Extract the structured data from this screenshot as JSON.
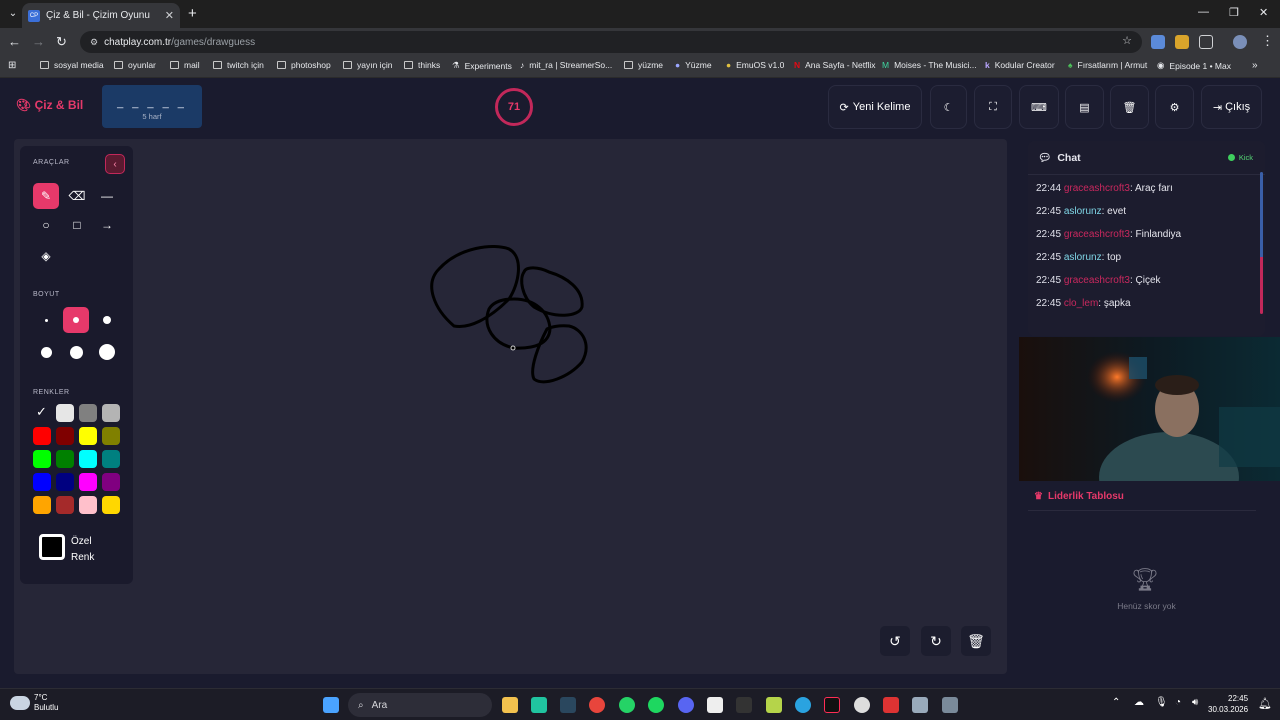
{
  "browser": {
    "tab_title": "Çiz & Bil - Çizim Oyunu",
    "tab_favicon": "CP",
    "url_host": "chatplay.com.tr",
    "url_path": "/games/drawguess",
    "bookmarks": [
      "sosyal media",
      "oyunlar",
      "mail",
      "twitch için",
      "photoshop",
      "yayın için",
      "thinks",
      "Experiments",
      "mit_ra | StreamerSo...",
      "yüzme",
      "Yüzme",
      "EmuOS v1.0",
      "Ana Sayfa - Netflix",
      "Moises - The Musici...",
      "Kodular Creator",
      "Fırsatlarım | Armut",
      "Episode 1 • Max"
    ]
  },
  "app": {
    "logo": "Çiz & Bil",
    "word_blanks": "_ _ _ _ _",
    "word_hint": "5 harf",
    "timer": "71",
    "header_buttons": {
      "new_word": "Yeni Kelime",
      "exit": "Çıkış"
    }
  },
  "tools": {
    "tools_label": "ARAÇLAR",
    "size_label": "BOYUT",
    "colors_label": "RENKLER",
    "custom_label": "Özel Renk",
    "colors": [
      "#ffffff",
      "#e6e6e6",
      "#808080",
      "#b4b4b4",
      "#ff0000",
      "#7f0000",
      "#ffff00",
      "#808000",
      "#00ff00",
      "#008000",
      "#00ffff",
      "#008080",
      "#0000ff",
      "#000080",
      "#ff00ff",
      "#800080",
      "#ffa500",
      "#a52a2a",
      "#ffc0cb",
      "#ffd700"
    ]
  },
  "chat": {
    "title": "Chat",
    "platform": "Kick",
    "messages": [
      {
        "time": "22:44",
        "user": "graceashcroft3",
        "text": ": Araç farı",
        "color": "#c9285e"
      },
      {
        "time": "22:45",
        "user": "aslorunz",
        "text": ": evet",
        "color": "#7fd6e6"
      },
      {
        "time": "22:45",
        "user": "graceashcroft3",
        "text": ": Finlandiya",
        "color": "#c9285e"
      },
      {
        "time": "22:45",
        "user": "aslorunz",
        "text": ": top",
        "color": "#7fd6e6"
      },
      {
        "time": "22:45",
        "user": "graceashcroft3",
        "text": ": Çiçek",
        "color": "#c9285e"
      },
      {
        "time": "22:45",
        "user": "clo_lem",
        "text": ": şapka",
        "color": "#c9285e"
      }
    ]
  },
  "leaderboard": {
    "title": "Liderlik Tablosu",
    "empty": "Henüz skor yok"
  },
  "taskbar": {
    "temp": "7°C",
    "weather": "Bulutlu",
    "search": "Ara",
    "time": "22:45",
    "date": "30.03.2026"
  }
}
